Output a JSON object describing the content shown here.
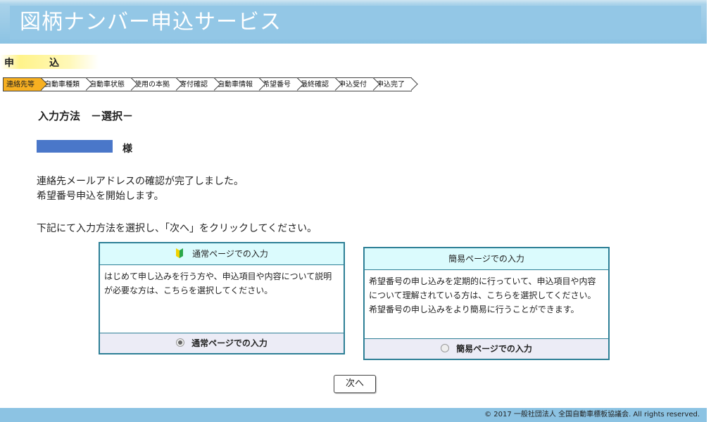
{
  "header": {
    "title": "図柄ナンバー申込サービス"
  },
  "section_label": {
    "char1": "申",
    "char2": "込"
  },
  "steps": [
    {
      "label": "連絡先等",
      "active": true
    },
    {
      "label": "自動車種類"
    },
    {
      "label": "自動車状態"
    },
    {
      "label": "使用の本拠"
    },
    {
      "label": "寄付確認"
    },
    {
      "label": "自動車情報"
    },
    {
      "label": "希望番号"
    },
    {
      "label": "最終確認"
    },
    {
      "label": "申込受付"
    },
    {
      "label": "申込完了"
    }
  ],
  "main": {
    "heading": "入力方法　－選択－",
    "honorific": "様",
    "message1": "連絡先メールアドレスの確認が完了しました。",
    "message2": "希望番号申込を開始します。",
    "instruction": "下記にて入力方法を選択し、「次へ」をクリックしてください。"
  },
  "options": {
    "normal": {
      "title": "通常ページでの入力",
      "description": "はじめて申し込みを行う方や、申込項目や内容について説明が必要な方は、こちらを選択してください。",
      "radio_label": "通常ページでの入力",
      "selected": true,
      "icon": "beginner-mark-icon"
    },
    "simple": {
      "title": "簡易ページでの入力",
      "description1": "希望番号の申し込みを定期的に行っていて、申込項目や内容について理解されている方は、こちらを選択してください。",
      "description2": "希望番号の申し込みをより簡易に行うことができます。",
      "radio_label": "簡易ページでの入力",
      "selected": false
    }
  },
  "next_button": {
    "label": "次へ"
  },
  "footer": {
    "copyright": "© 2017 一般社団法人 全国自動車標板協議会. All rights reserved."
  },
  "colors": {
    "header": "#8cc3e3",
    "active_step": "#f7b021",
    "option_border": "#2d7f96",
    "redacted_name": "#4a77c9"
  }
}
